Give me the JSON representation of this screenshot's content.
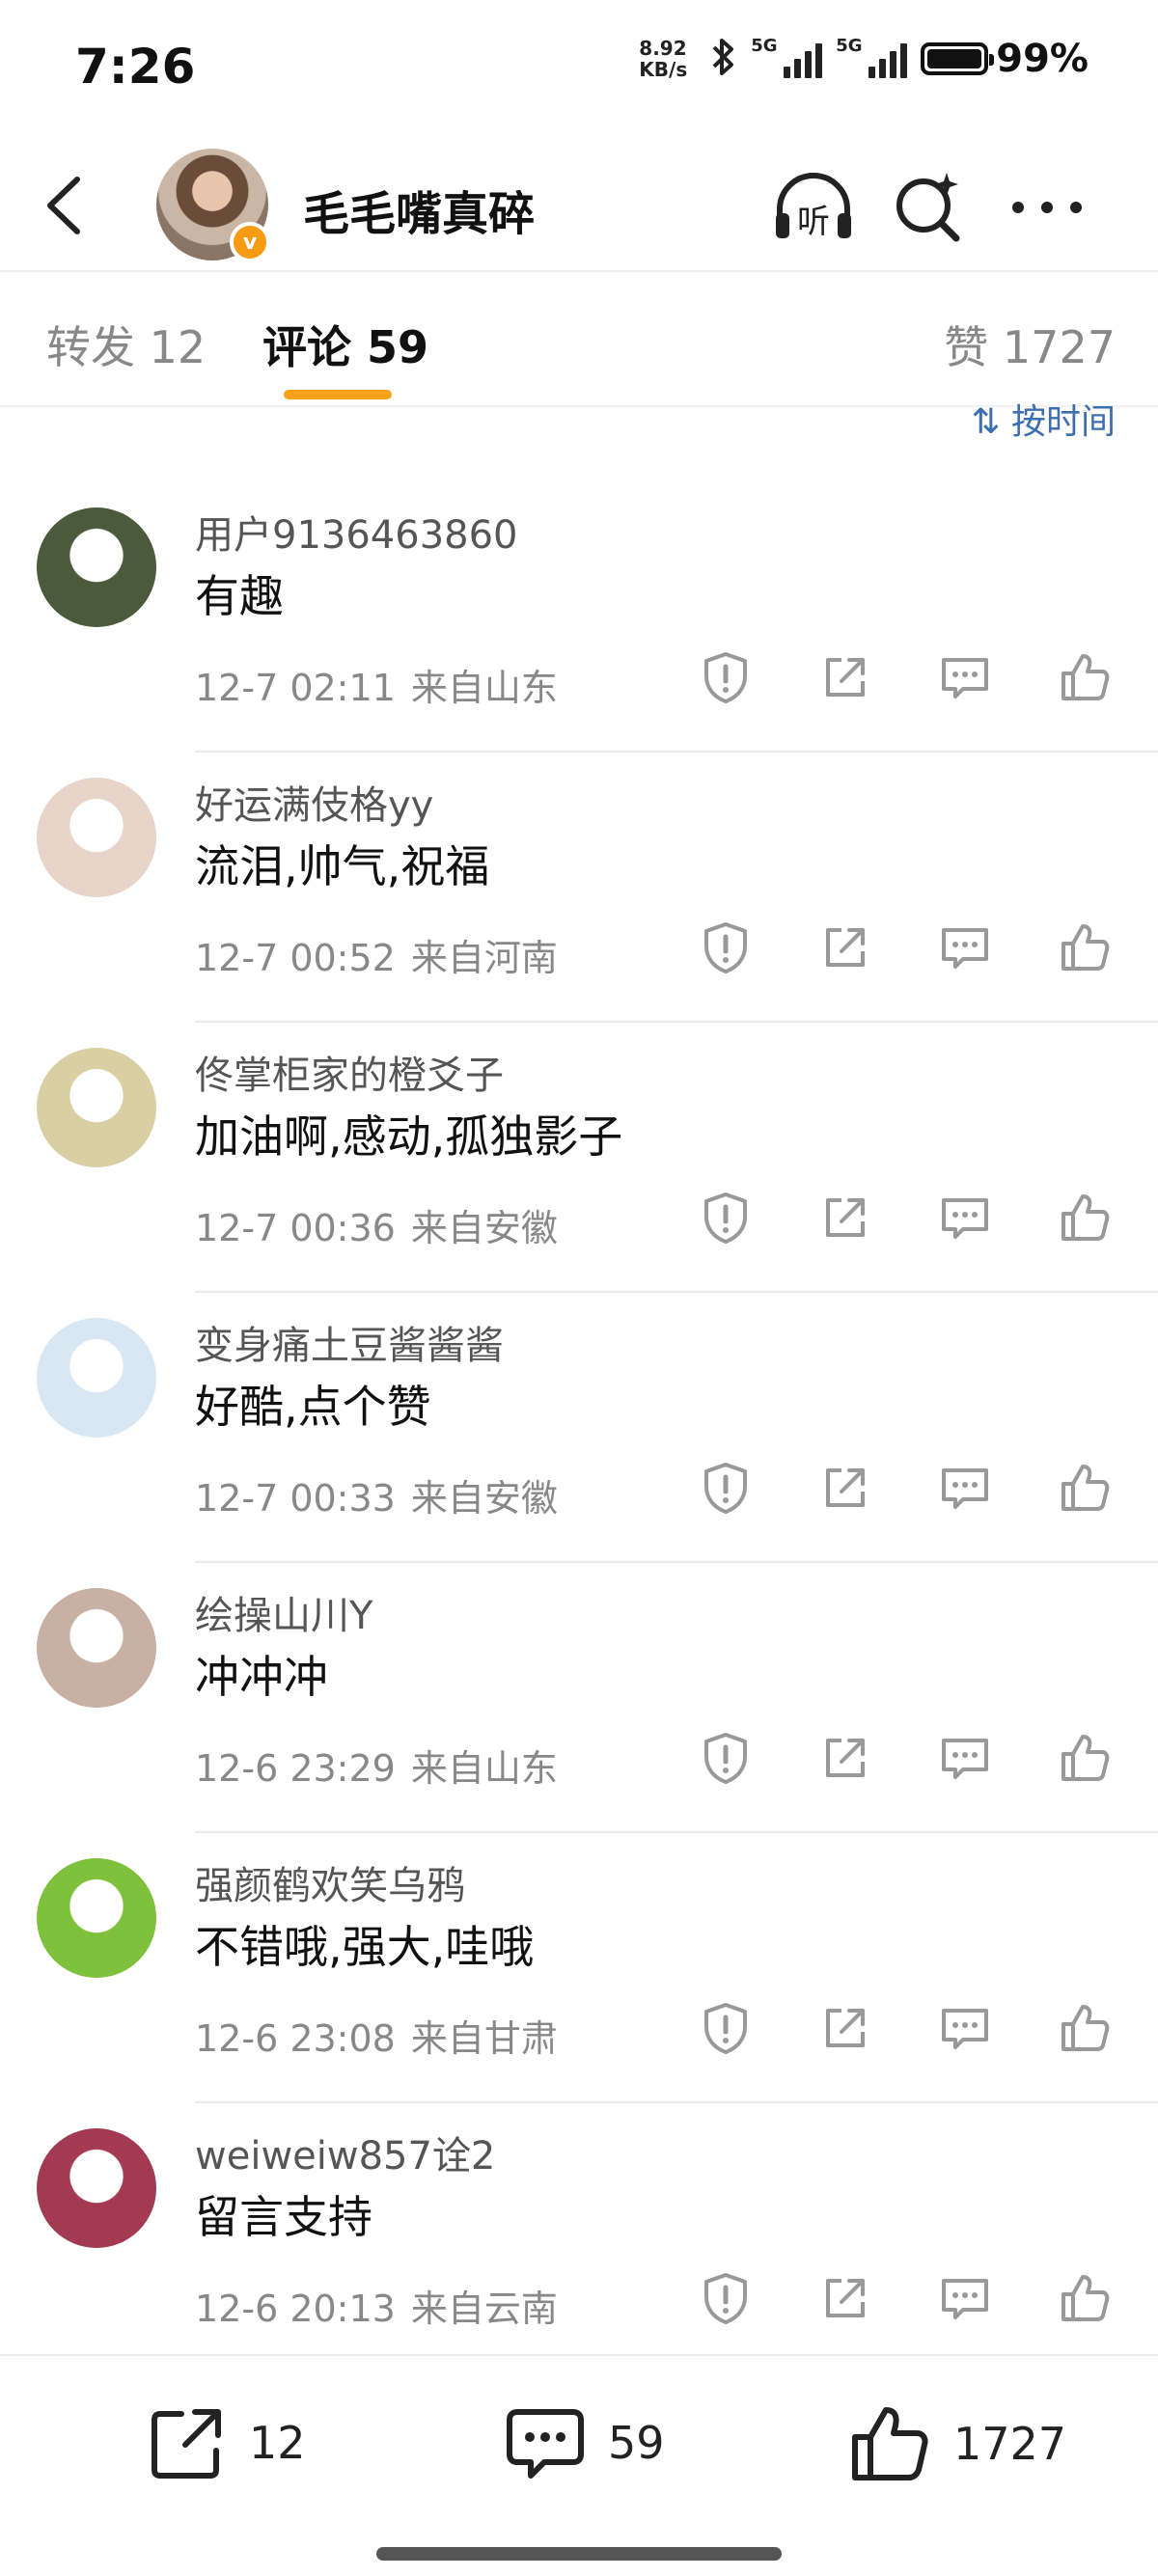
{
  "status": {
    "time": "7:26",
    "net_speed_value": "8.92",
    "net_speed_unit": "KB/s",
    "sim1": "5G",
    "sim2": "5G",
    "battery": "99%"
  },
  "header": {
    "username": "毛毛嘴真碎",
    "listen_label": "听",
    "verified_mark": "v"
  },
  "tabs": {
    "repost": "转发 12",
    "comments": "评论 59",
    "likes": "赞 1727"
  },
  "sort_label": "⇅ 按时间",
  "comments": [
    {
      "name": "用户9136463860",
      "text": "有趣",
      "date": "12-7 02:11",
      "location": "来自山东",
      "avatar_color": "#4a5a3a"
    },
    {
      "name": "好运满伎格yy",
      "text": "流泪,帅气,祝福",
      "date": "12-7 00:52",
      "location": "来自河南",
      "avatar_color": "#e7d5c9"
    },
    {
      "name": "佟掌柜家的橙爻子",
      "text": "加油啊,感动,孤独影子",
      "date": "12-7 00:36",
      "location": "来自安徽",
      "avatar_color": "#d8cfa2"
    },
    {
      "name": "变身痛土豆酱酱酱",
      "text": "好酷,点个赞",
      "date": "12-7 00:33",
      "location": "来自安徽",
      "avatar_color": "#d9e7f2"
    },
    {
      "name": "绘操山川Y",
      "text": "冲冲冲",
      "date": "12-6 23:29",
      "location": "来自山东",
      "avatar_color": "#c8b1a4"
    },
    {
      "name": "强颜鹤欢笑乌鸦",
      "text": "不错哦,强大,哇哦",
      "date": "12-6 23:08",
      "location": "来自甘肃",
      "avatar_color": "#7fc13c"
    },
    {
      "name": "weiweiw857诠2",
      "text": "留言支持",
      "date": "12-6 20:13",
      "location": "来自云南",
      "avatar_color": "#a33a52"
    }
  ],
  "bottom": {
    "repost_count": "12",
    "comment_count": "59",
    "like_count": "1727"
  },
  "colors": {
    "accent": "#f7a21a",
    "sort_link": "#3d6fb0",
    "verified": "#f79b15"
  }
}
